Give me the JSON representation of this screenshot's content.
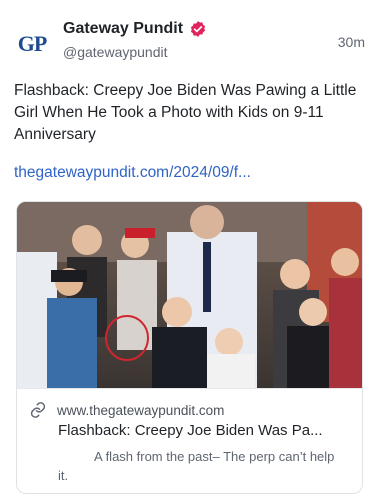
{
  "post": {
    "author": {
      "avatar_text": "GP",
      "display_name": "Gateway Pundit",
      "handle": "@gatewaypundit",
      "verified": true
    },
    "timestamp": "30m",
    "text": "Flashback: Creepy Joe Biden Was Pawing a Little Girl When He Took a Photo with Kids on 9-11 Anniversary",
    "link": "thegatewaypundit.com/2024/09/f..."
  },
  "card": {
    "image_icon": "photo-of-crowd-with-children",
    "domain": "www.thegatewaypundit.com",
    "title": "Flashback: Creepy Joe Biden Was Pa...",
    "description": "A flash from the past– The perp can’t help it.",
    "link_icon": "link-icon"
  },
  "colors": {
    "brand_blue": "#1f4c8f",
    "link": "#2f63c6",
    "verified_badge": "#e0245e",
    "muted": "#5f6670"
  }
}
